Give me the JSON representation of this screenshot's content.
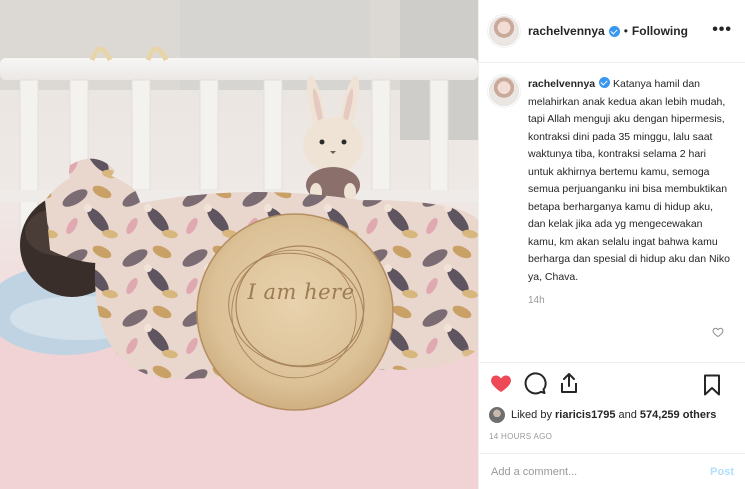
{
  "photo": {
    "engraved_text": "I am here"
  },
  "post": {
    "username": "rachelvennya",
    "follow_separator": "•",
    "follow_status": "Following",
    "more_glyph": "•••",
    "caption": "Katanya hamil dan melahirkan anak kedua akan lebih mudah, tapi Allah menguji aku dengan hipermesis, kontraksi dini pada 35 minggu, lalu saat waktunya tiba, kontraksi selama 2 hari untuk akhirnya bertemu kamu, semoga semua perjuanganku ini bisa membuktikan betapa berharganya kamu di hidup aku, dan kelak jika ada yg mengecewakan kamu, km akan selalu ingat bahwa kamu berharga dan spesial di hidup aku dan Niko ya, Chava.",
    "caption_age": "14h",
    "likes": {
      "prefix": "Liked by",
      "user": "riaricis1795",
      "conjunction": "and",
      "count": "574,259 others"
    },
    "timestamp": "14 HOURS AGO",
    "comment_placeholder": "Add a comment...",
    "post_label": "Post"
  },
  "colors": {
    "like_red": "#ed4956",
    "verified_blue": "#3897f0",
    "post_disabled": "#b2dffc"
  },
  "icons": {
    "like": "heart-filled-icon",
    "comment": "comment-bubble-icon",
    "share": "share-upload-icon",
    "save": "bookmark-icon",
    "caption_like": "heart-outline-icon",
    "verified": "verified-badge-icon",
    "more": "more-options-icon"
  }
}
